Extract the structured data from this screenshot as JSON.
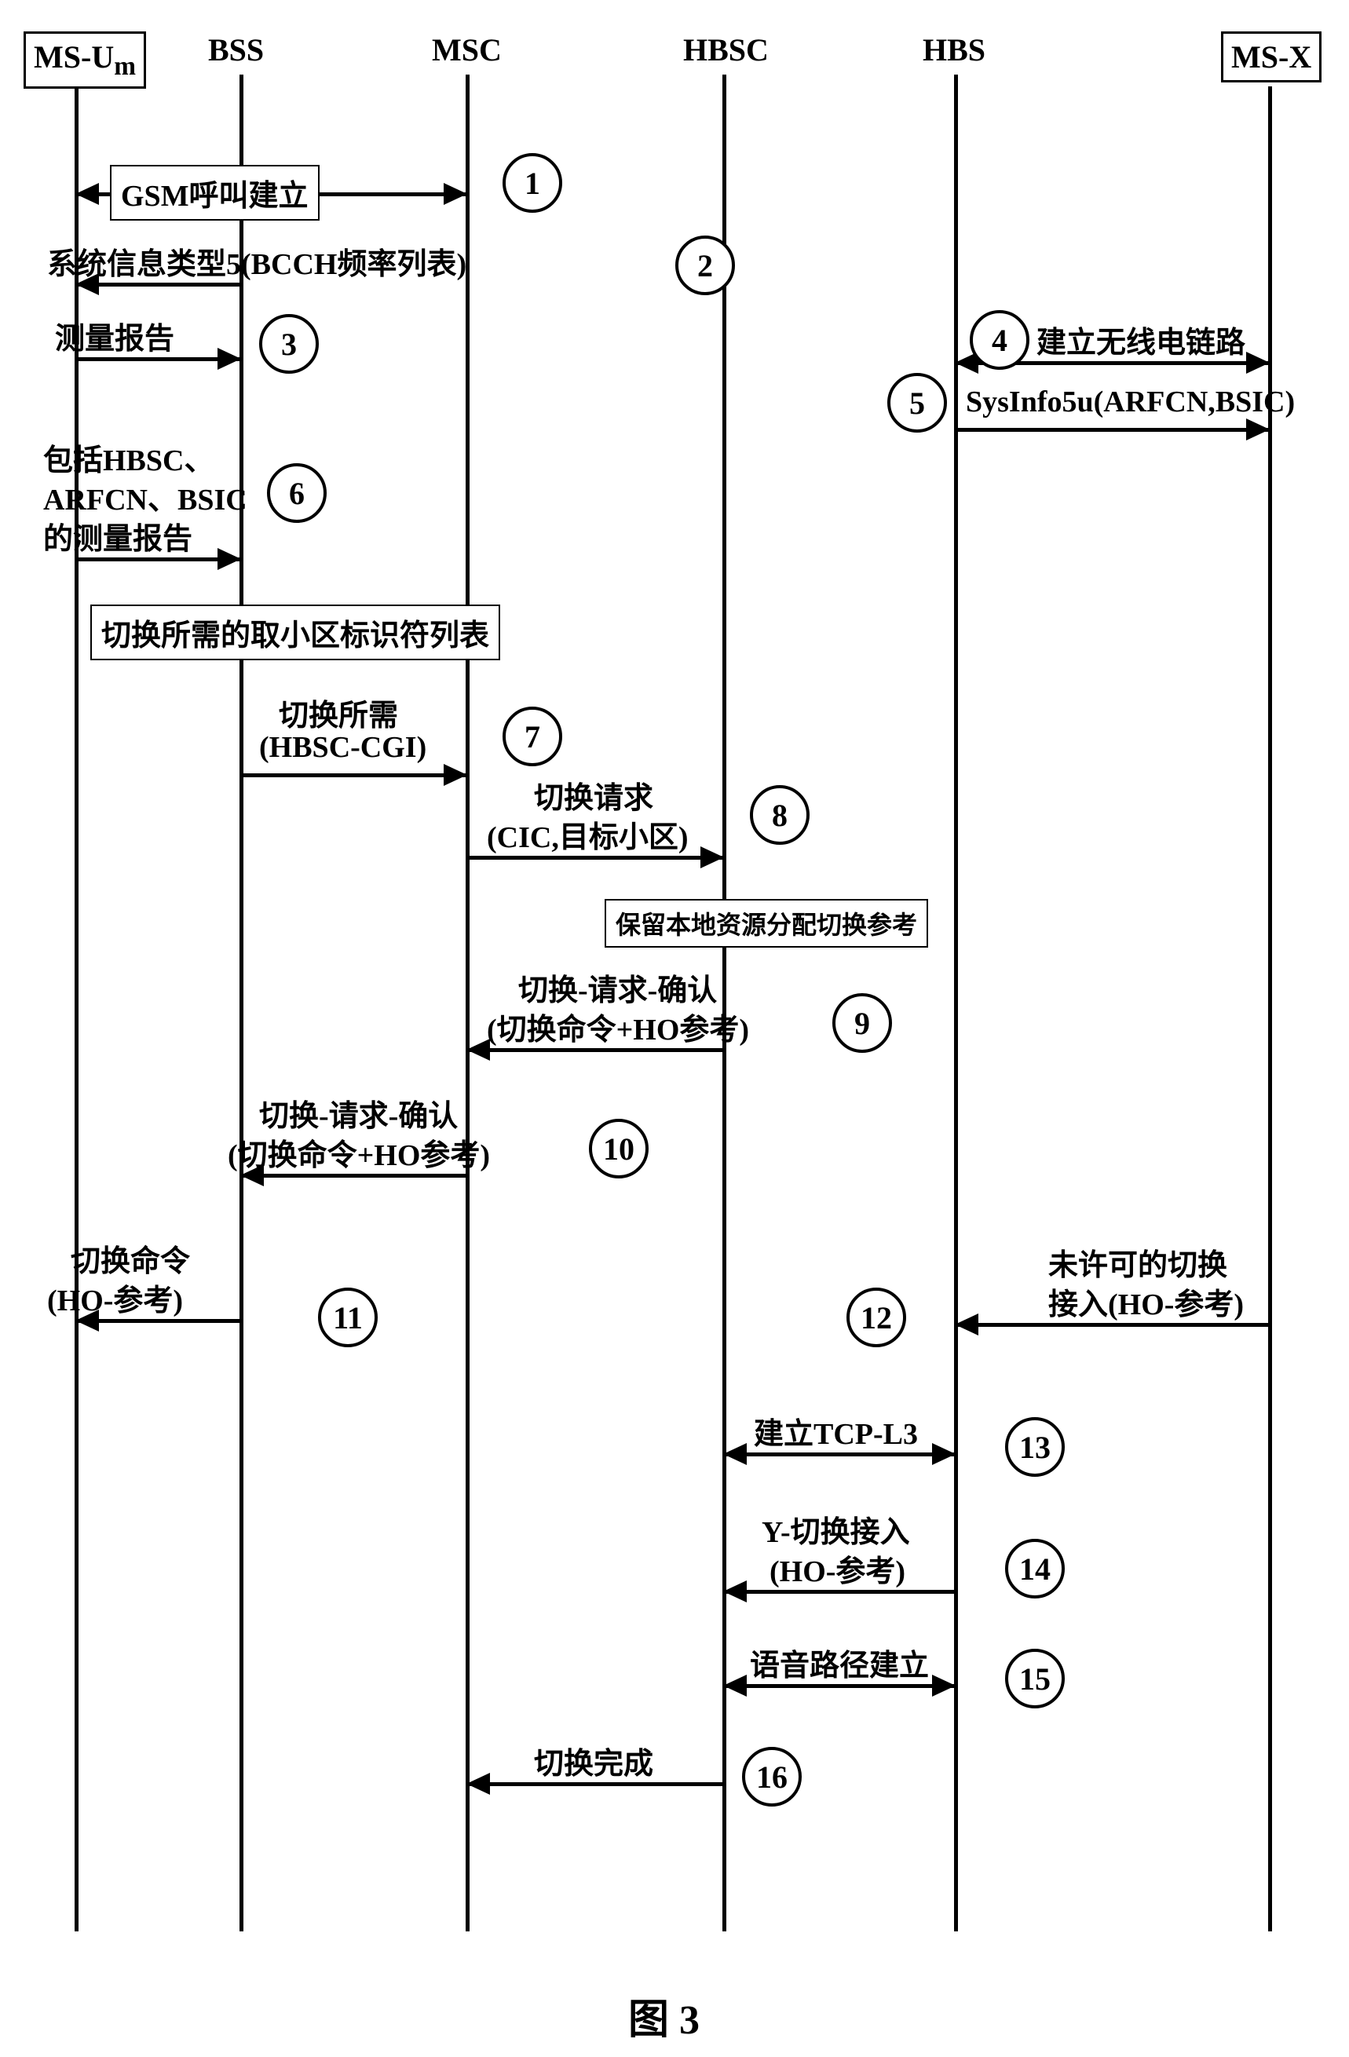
{
  "figure_caption": "图 3",
  "actors": {
    "msum": "MS-U",
    "msum_sub": "m",
    "bss": "BSS",
    "msc": "MSC",
    "hbsc": "HBSC",
    "hbs": "HBS",
    "msx": "MS-X"
  },
  "steps": {
    "s1": "1",
    "s2": "2",
    "s3": "3",
    "s4": "4",
    "s5": "5",
    "s6": "6",
    "s7": "7",
    "s8": "8",
    "s9": "9",
    "s10": "10",
    "s11": "11",
    "s12": "12",
    "s13": "13",
    "s14": "14",
    "s15": "15",
    "s16": "16"
  },
  "msgs": {
    "gsm_call_setup": "GSM呼叫建立",
    "sysinfo5_bcch": "系统信息类型5(BCCH频率列表)",
    "measurement_report": "测量报告",
    "establish_radio_link": "建立无线电链路",
    "sysinfo5u": "SysInfo5u(ARFCN,BSIC)",
    "measurement_report_hbsc_l1": "包括HBSC、",
    "measurement_report_hbsc_l2": "ARFCN、BSIC",
    "measurement_report_hbsc_l3": "的测量报告",
    "ho_required_cell_list": "切换所需的取小区标识符列表",
    "ho_required_l1": "切换所需",
    "ho_required_l2": "(HBSC-CGI)",
    "ho_request_l1": "切换请求",
    "ho_request_l2": "(CIC,目标小区)",
    "reserve_local_resource": "保留本地资源分配切换参考",
    "ho_req_ack_9_l1": "切换-请求-确认",
    "ho_req_ack_9_l2": "(切换命令+HO参考)",
    "ho_req_ack_10_l1": "切换-请求-确认",
    "ho_req_ack_10_l2": "(切换命令+HO参考)",
    "ho_command_l1": "切换命令",
    "ho_command_l2": "(HO-参考)",
    "unlic_ho_access_l1": "未许可的切换",
    "unlic_ho_access_l2": "接入(HO-参考)",
    "establish_tcp_l3": "建立TCP-L3",
    "y_ho_access_l1": "Y-切换接入",
    "y_ho_access_l2": "(HO-参考)",
    "voice_path_setup": "语音路径建立",
    "ho_complete": "切换完成"
  }
}
